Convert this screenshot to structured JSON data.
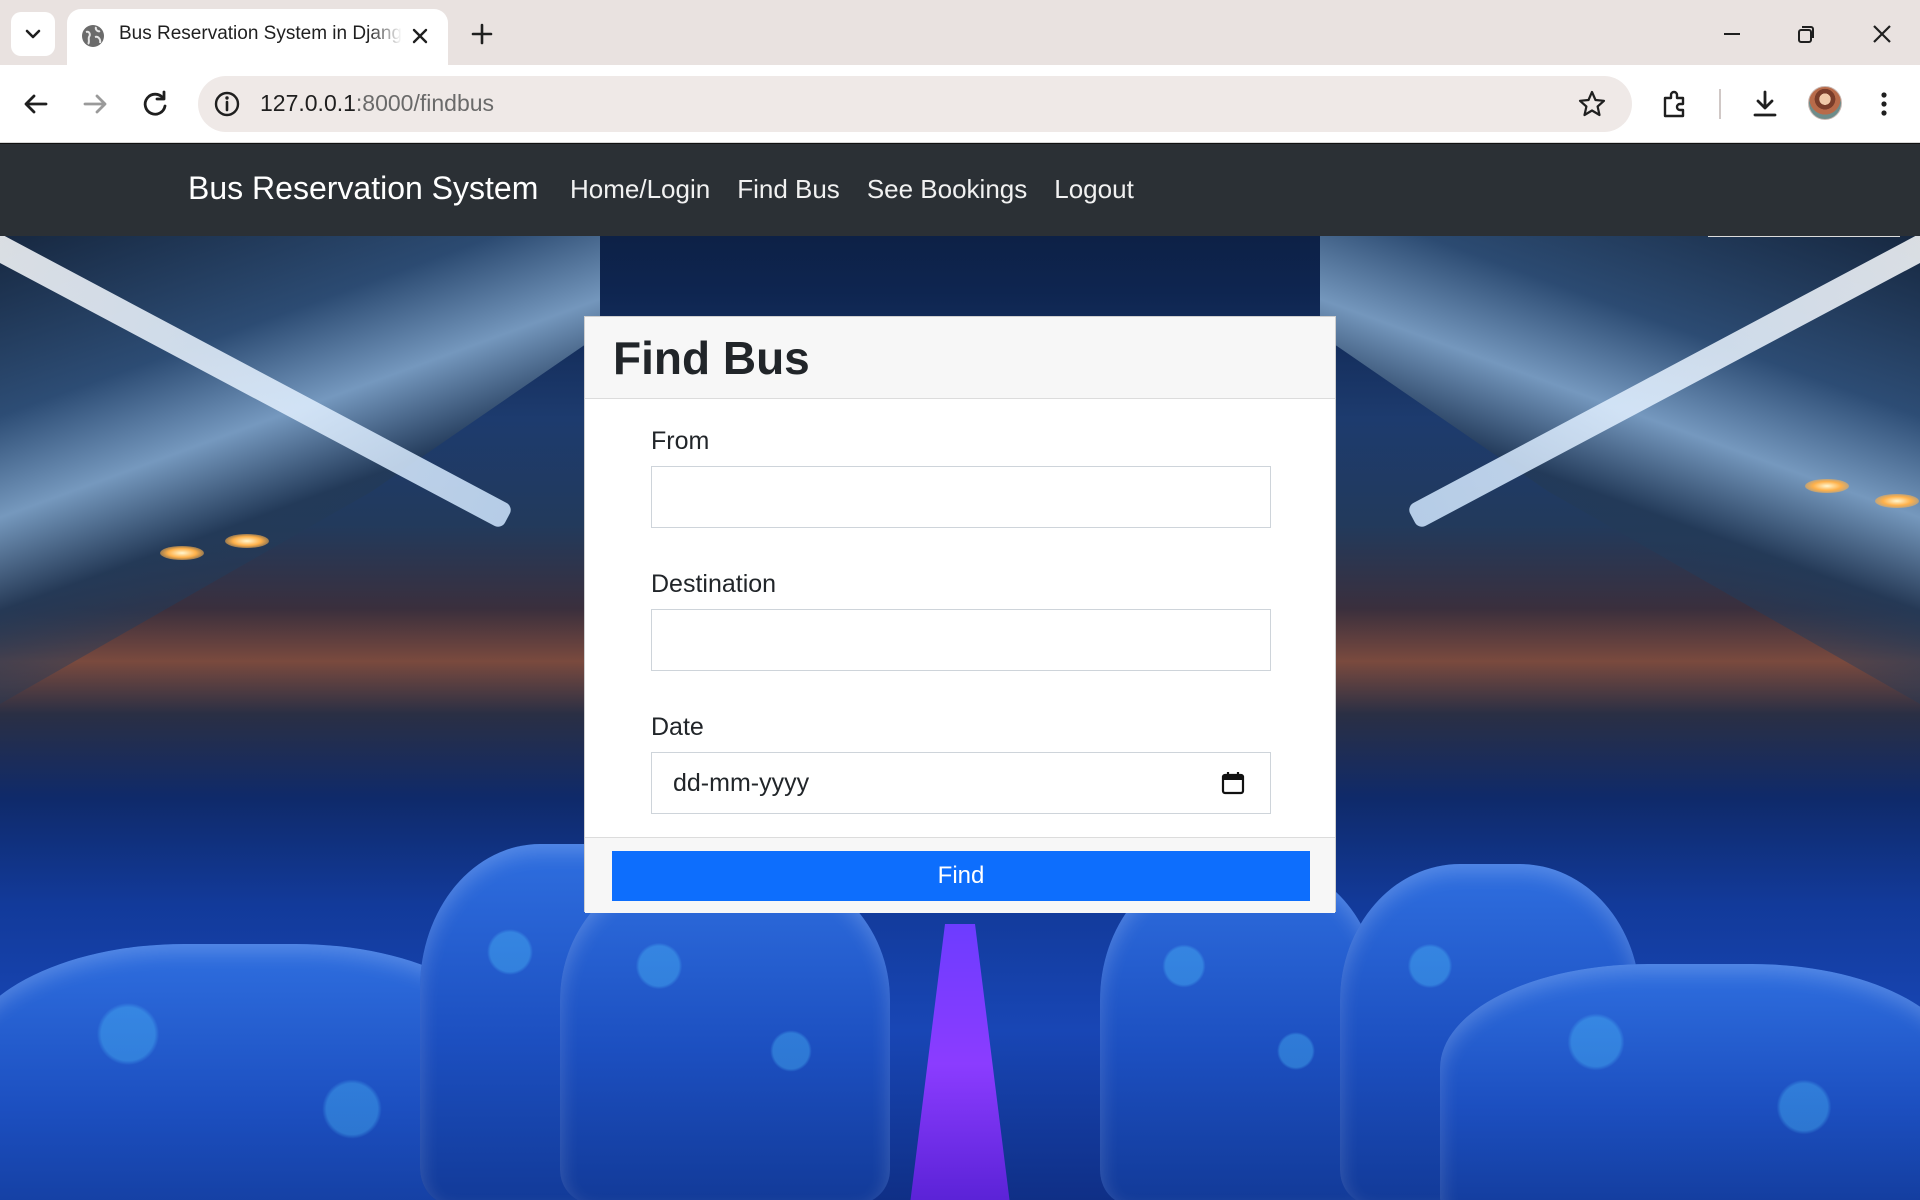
{
  "browser": {
    "tab_title": "Bus Reservation System in Django",
    "url_host": "127.0.0.1",
    "url_rest": ":8000/findbus"
  },
  "navbar": {
    "brand": "Bus Reservation System",
    "links": [
      "Home/Login",
      "Find Bus",
      "See Bookings",
      "Logout"
    ],
    "background": "#2b3035"
  },
  "form": {
    "title": "Find Bus",
    "from_label": "From",
    "from_value": "",
    "destination_label": "Destination",
    "destination_value": "",
    "date_label": "Date",
    "date_placeholder": "dd-mm-yyyy",
    "submit_label": "Find",
    "accent": "#0d6efd"
  },
  "icons": [
    "tab-search-icon",
    "globe-icon",
    "close-icon",
    "plus-icon",
    "minimize-icon",
    "restore-icon",
    "window-close-icon",
    "back-icon",
    "forward-icon",
    "reload-icon",
    "info-icon",
    "star-icon",
    "extensions-icon",
    "download-icon",
    "avatar",
    "menu-icon",
    "calendar-icon"
  ]
}
